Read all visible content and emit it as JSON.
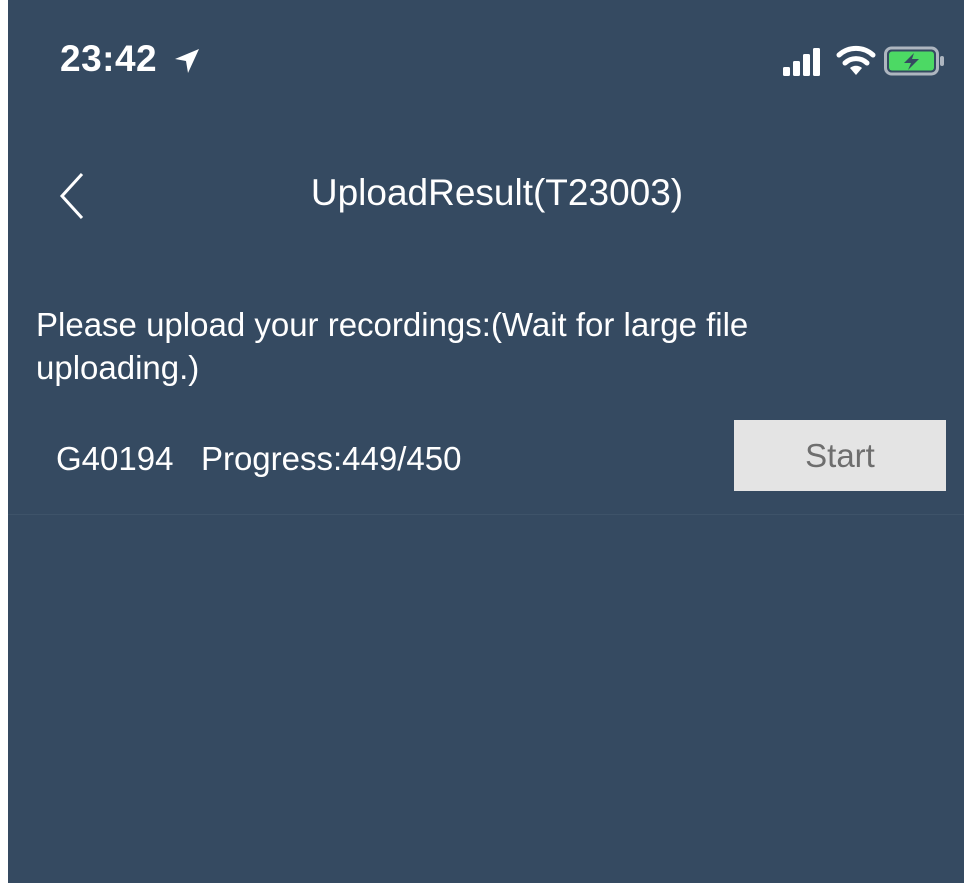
{
  "status_bar": {
    "time": "23:42",
    "icons": [
      "location-arrow-icon",
      "cellular-signal-icon",
      "wifi-icon",
      "battery-charging-icon"
    ],
    "battery_color": "#4cd964"
  },
  "nav": {
    "back_icon": "chevron-left-icon",
    "title": "UploadResult(T23003)"
  },
  "content": {
    "instruction": "Please upload your recordings:(Wait for large file uploading.)",
    "upload_item": {
      "id": "G40194",
      "progress_text": "Progress:449/450",
      "progress_done": 449,
      "progress_total": 450,
      "button_label": "Start"
    }
  },
  "colors": {
    "background": "#354a61",
    "button_bg": "#e4e4e4",
    "button_text": "#6e6e6e"
  }
}
